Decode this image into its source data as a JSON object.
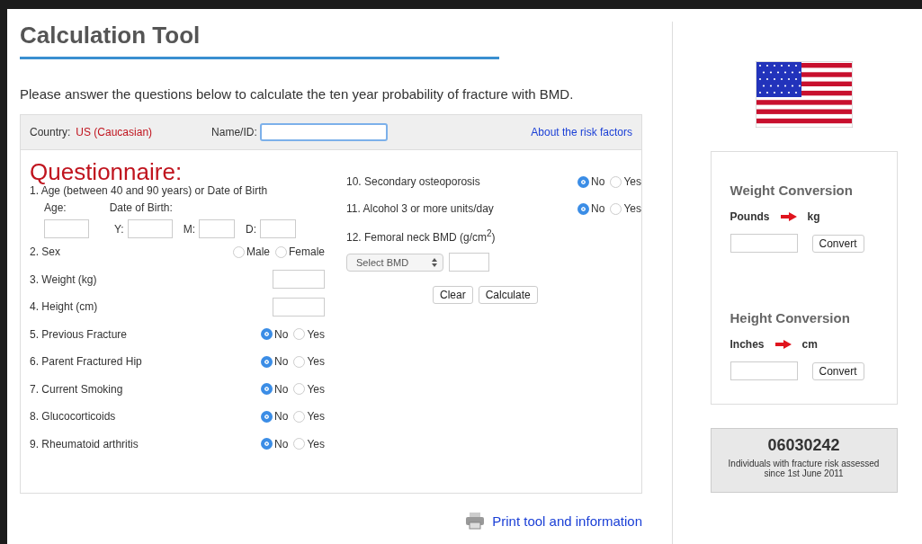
{
  "title": "Calculation Tool",
  "intro": "Please answer the questions below to calculate the ten year probability of fracture with BMD.",
  "header": {
    "country_label": "Country:",
    "country": "US (Caucasian)",
    "name_label": "Name/ID:",
    "link": "About the risk factors"
  },
  "questionnaire_title": "Questionnaire:",
  "left_questions": [
    {
      "kind": "age",
      "label": "1. Age (between 40 and 90 years) or Date of Birth",
      "age_label": "Age:",
      "dob_label": "Date of Birth:",
      "parts": [
        "Y:",
        "M:",
        "D:"
      ]
    },
    {
      "kind": "radio",
      "label": "2. Sex",
      "options": [
        {
          "label": "Male",
          "selected": false
        },
        {
          "label": "Female",
          "selected": false
        }
      ]
    },
    {
      "kind": "input",
      "label": "3. Weight (kg)"
    },
    {
      "kind": "input",
      "label": "4. Height (cm)"
    },
    {
      "kind": "radio",
      "label": "5. Previous Fracture",
      "options": [
        {
          "label": "No",
          "selected": true
        },
        {
          "label": "Yes",
          "selected": false
        }
      ]
    },
    {
      "kind": "radio",
      "label": "6. Parent Fractured Hip",
      "options": [
        {
          "label": "No",
          "selected": true
        },
        {
          "label": "Yes",
          "selected": false
        }
      ]
    },
    {
      "kind": "radio",
      "label": "7. Current Smoking",
      "options": [
        {
          "label": "No",
          "selected": true
        },
        {
          "label": "Yes",
          "selected": false
        }
      ]
    },
    {
      "kind": "radio",
      "label": "8. Glucocorticoids",
      "options": [
        {
          "label": "No",
          "selected": true
        },
        {
          "label": "Yes",
          "selected": false
        }
      ]
    },
    {
      "kind": "radio",
      "label": "9. Rheumatoid arthritis",
      "options": [
        {
          "label": "No",
          "selected": true
        },
        {
          "label": "Yes",
          "selected": false
        }
      ]
    }
  ],
  "right_questions": [
    {
      "kind": "radio",
      "label": "10. Secondary osteoporosis",
      "options": [
        {
          "label": "No",
          "selected": true
        },
        {
          "label": "Yes",
          "selected": false
        }
      ]
    },
    {
      "kind": "radio",
      "label": "11. Alcohol 3 or more units/day",
      "options": [
        {
          "label": "No",
          "selected": true
        },
        {
          "label": "Yes",
          "selected": false
        }
      ]
    },
    {
      "kind": "bmd",
      "label": "12. Femoral neck BMD (g/cm$^{2}$)",
      "select": "Select BMD"
    }
  ],
  "buttons": [
    "Clear",
    "Calculate"
  ],
  "print_link": "Print tool and information",
  "converters": [
    {
      "title": "Weight Conversion",
      "from": "Pounds",
      "to": "kg",
      "button": "Convert"
    },
    {
      "title": "Height Conversion",
      "from": "Inches",
      "to": "cm",
      "button": "Convert"
    }
  ],
  "counter": {
    "value": "06030242",
    "caption": "Individuals with fracture risk assessed since 1st June 2011"
  }
}
